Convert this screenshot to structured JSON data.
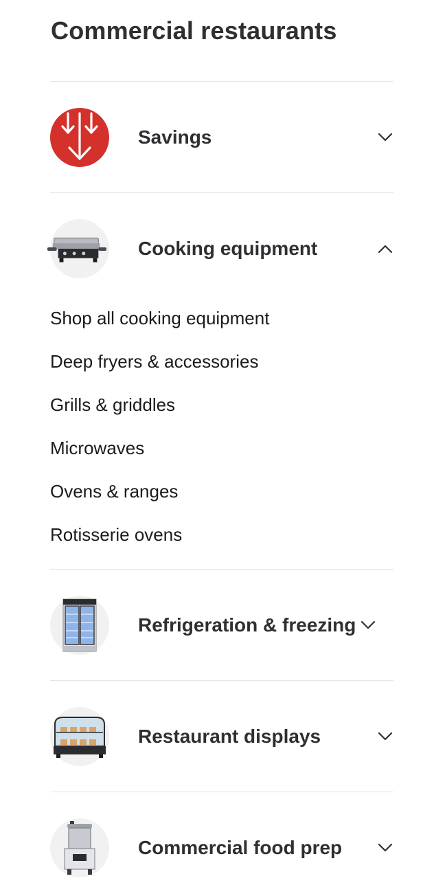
{
  "page": {
    "title": "Commercial restaurants"
  },
  "categories": [
    {
      "label": "Savings",
      "icon": "savings-arrows-icon",
      "expanded": false
    },
    {
      "label": "Cooking equipment",
      "icon": "griddle-icon",
      "expanded": true,
      "subitems": [
        "Shop all cooking equipment",
        "Deep fryers & accessories",
        "Grills & griddles",
        "Microwaves",
        "Ovens & ranges",
        "Rotisserie ovens"
      ]
    },
    {
      "label": "Refrigeration & freezing",
      "icon": "refrigerator-icon",
      "expanded": false
    },
    {
      "label": "Restaurant displays",
      "icon": "display-case-icon",
      "expanded": false
    },
    {
      "label": "Commercial food prep",
      "icon": "food-processor-icon",
      "expanded": false
    }
  ],
  "colors": {
    "accent_red": "#d5312c",
    "text": "#2e2f32",
    "divider": "#e3e4e5",
    "thumb_bg": "#f1f1f2"
  }
}
